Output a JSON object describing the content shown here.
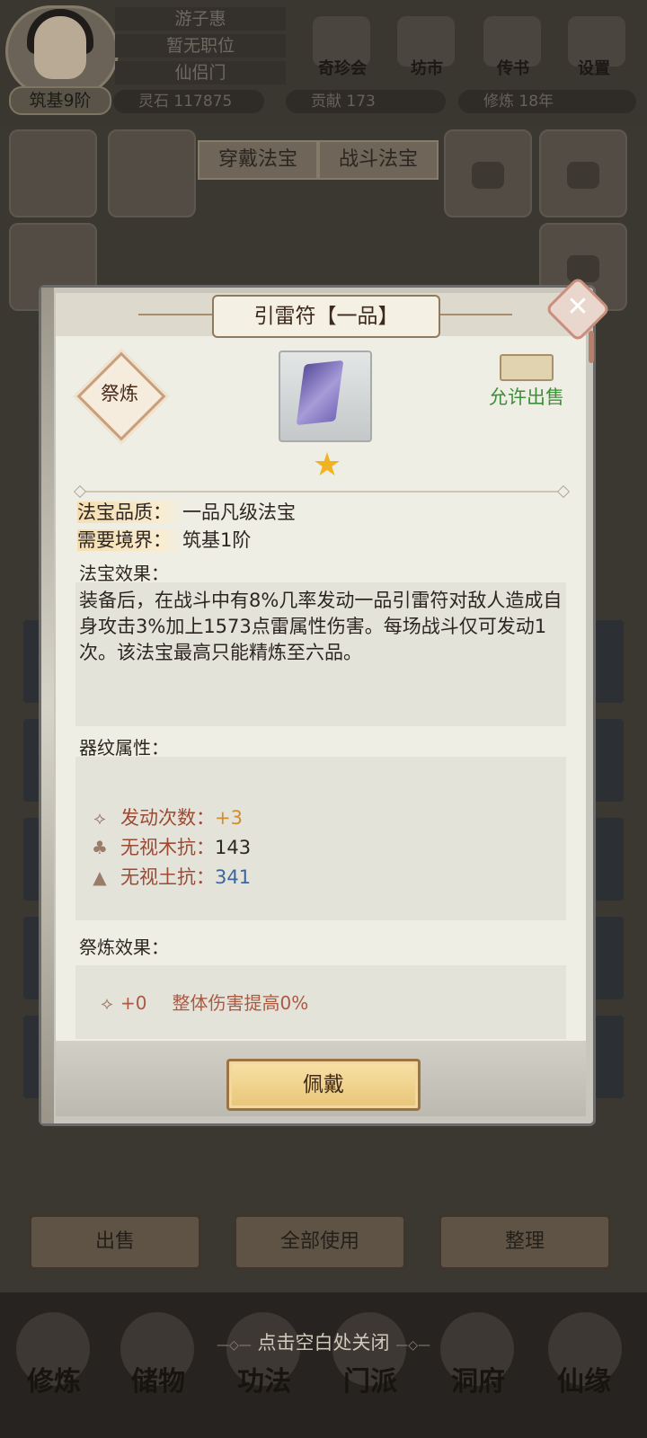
{
  "header": {
    "player_name": "游子惠",
    "position": "暂无职位",
    "sect": "仙侣门",
    "realm_badge": "筑基9阶",
    "menu": [
      {
        "label": "奇珍会",
        "icon": "treasure-shop-icon"
      },
      {
        "label": "坊市",
        "icon": "market-icon"
      },
      {
        "label": "传书",
        "icon": "mail-icon"
      },
      {
        "label": "设置",
        "icon": "gear-icon"
      }
    ],
    "resources": [
      {
        "name": "灵石",
        "value": "117875"
      },
      {
        "name": "贡献",
        "value": "173"
      },
      {
        "name": "修炼",
        "value": "18年"
      }
    ]
  },
  "equipment_tabs": [
    "穿戴法宝",
    "战斗法宝"
  ],
  "bottom_buttons": [
    "出售",
    "全部使用",
    "整理"
  ],
  "nav": [
    "修炼",
    "储物",
    "功法",
    "门派",
    "洞府",
    "仙缘"
  ],
  "close_hint": "点击空白处关闭",
  "dialog": {
    "title": "引雷符【一品】",
    "refine_badge": "祭炼",
    "sell_status": "允许出售",
    "stars": 1,
    "quality_key": "法宝品质：",
    "quality_value": "一品凡级法宝",
    "realm_key": "需要境界：",
    "realm_value": "筑基1阶",
    "effect_title": "法宝效果：",
    "effect_text": "装备后，在战斗中有8%几率发动一品引雷符对敌人造成自身攻击3%加上1573点雷属性伤害。每场战斗仅可发动1次。该法宝最高只能精炼至六品。",
    "glyph_title": "器纹属性：",
    "glyphs": [
      {
        "icon": "trigger-count-icon",
        "key": "发动次数：",
        "value": "+3"
      },
      {
        "icon": "wood-resist-icon",
        "key": "无视木抗：",
        "value": "143"
      },
      {
        "icon": "earth-resist-icon",
        "key": "无视土抗：",
        "value": "341"
      }
    ],
    "refine_title": "祭炼效果：",
    "refine_value": "+0",
    "refine_text": "整体伤害提高0%",
    "equip_button": "佩戴"
  }
}
